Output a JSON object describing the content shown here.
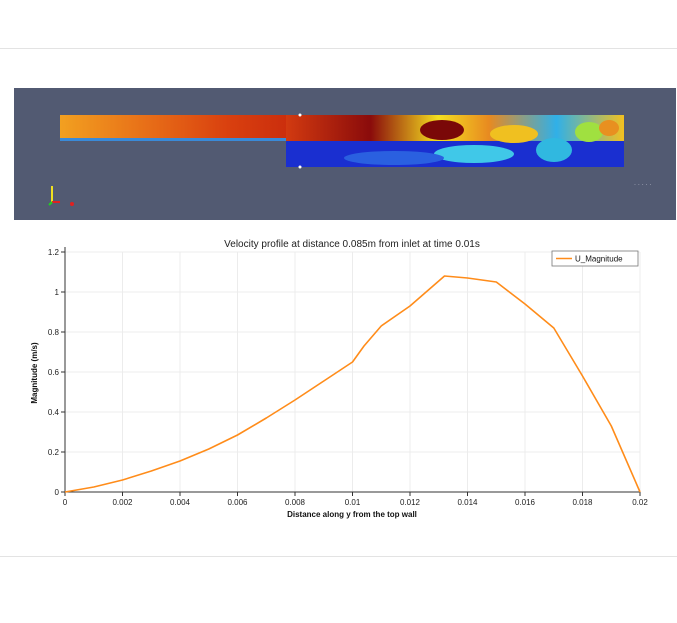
{
  "chart_data": {
    "type": "line",
    "title": "Velocity profile at distance 0.085m from inlet at time 0.01s",
    "xlabel": "Distance along y from the top wall",
    "ylabel": "Magnitude (m/s)",
    "xlim": [
      0,
      0.02
    ],
    "ylim": [
      0,
      1.2
    ],
    "xticks": [
      0,
      0.002,
      0.004,
      0.006,
      0.008,
      0.01,
      0.012,
      0.014,
      0.016,
      0.018,
      0.02
    ],
    "xtick_labels": [
      "0",
      "0.002",
      "0.004",
      "0.006",
      "0.008",
      "0.01",
      "0.012",
      "0.014",
      "0.016",
      "0.018",
      "0.02"
    ],
    "yticks": [
      0,
      0.2,
      0.4,
      0.6,
      0.8,
      1,
      1.2
    ],
    "ytick_labels": [
      "0",
      "0.2",
      "0.4",
      "0.6",
      "0.8",
      "1",
      "1.2"
    ],
    "grid": true,
    "legend_position": "top-right",
    "series": [
      {
        "name": "U_Magnitude",
        "color": "#ff8c1a",
        "x": [
          0,
          0.001,
          0.002,
          0.003,
          0.004,
          0.005,
          0.006,
          0.007,
          0.008,
          0.009,
          0.01,
          0.0104,
          0.011,
          0.012,
          0.0132,
          0.014,
          0.015,
          0.016,
          0.017,
          0.018,
          0.019,
          0.02
        ],
        "y": [
          0,
          0.025,
          0.06,
          0.105,
          0.155,
          0.215,
          0.285,
          0.37,
          0.46,
          0.555,
          0.65,
          0.73,
          0.83,
          0.93,
          1.08,
          1.07,
          1.05,
          0.94,
          0.82,
          0.58,
          0.33,
          0.0
        ]
      }
    ]
  },
  "simulation_view": {
    "background": "#525a72"
  }
}
